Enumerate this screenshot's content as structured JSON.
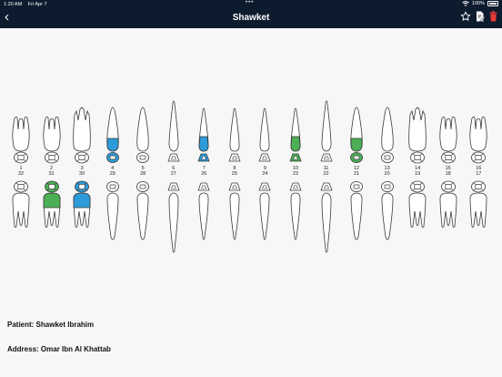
{
  "status_bar": {
    "time": "1:20 AM",
    "date": "Fri Apr 7",
    "battery": "100%"
  },
  "header": {
    "title": "Shawket"
  },
  "upper_teeth": [
    {
      "num": "1",
      "type": "molar",
      "fill": "none"
    },
    {
      "num": "2",
      "type": "molar",
      "fill": "none"
    },
    {
      "num": "3",
      "type": "molar3",
      "fill": "none"
    },
    {
      "num": "4",
      "type": "premolar",
      "fill": "blue"
    },
    {
      "num": "5",
      "type": "premolar",
      "fill": "none"
    },
    {
      "num": "6",
      "type": "canine",
      "fill": "none"
    },
    {
      "num": "7",
      "type": "incisor",
      "fill": "blue"
    },
    {
      "num": "8",
      "type": "incisor",
      "fill": "none"
    },
    {
      "num": "9",
      "type": "incisor",
      "fill": "none"
    },
    {
      "num": "10",
      "type": "incisor",
      "fill": "green"
    },
    {
      "num": "11",
      "type": "canine",
      "fill": "none"
    },
    {
      "num": "12",
      "type": "premolar",
      "fill": "green"
    },
    {
      "num": "13",
      "type": "premolar",
      "fill": "none"
    },
    {
      "num": "14",
      "type": "molar3",
      "fill": "none"
    },
    {
      "num": "15",
      "type": "molar",
      "fill": "none"
    },
    {
      "num": "16",
      "type": "molar",
      "fill": "none"
    }
  ],
  "upper_occlusal_fill": [
    "none",
    "none",
    "none",
    "blue",
    "none",
    "none",
    "blue",
    "none",
    "none",
    "green",
    "none",
    "green",
    "none",
    "none",
    "none",
    "none"
  ],
  "lower_teeth": [
    {
      "num": "32",
      "type": "molar",
      "fill": "none"
    },
    {
      "num": "31",
      "type": "molar",
      "fill": "green"
    },
    {
      "num": "30",
      "type": "molar",
      "fill": "blue"
    },
    {
      "num": "29",
      "type": "premolar",
      "fill": "none"
    },
    {
      "num": "28",
      "type": "premolar",
      "fill": "none"
    },
    {
      "num": "27",
      "type": "canine",
      "fill": "none"
    },
    {
      "num": "26",
      "type": "incisor",
      "fill": "none"
    },
    {
      "num": "25",
      "type": "incisor",
      "fill": "none"
    },
    {
      "num": "24",
      "type": "incisor",
      "fill": "none"
    },
    {
      "num": "23",
      "type": "incisor",
      "fill": "none"
    },
    {
      "num": "22",
      "type": "canine",
      "fill": "none"
    },
    {
      "num": "21",
      "type": "premolar",
      "fill": "none"
    },
    {
      "num": "20",
      "type": "premolar",
      "fill": "none"
    },
    {
      "num": "19",
      "type": "molar",
      "fill": "none"
    },
    {
      "num": "18",
      "type": "molar",
      "fill": "none"
    },
    {
      "num": "17",
      "type": "molar",
      "fill": "none"
    }
  ],
  "lower_occlusal_fill": [
    "none",
    "green",
    "blue",
    "none",
    "none",
    "none",
    "none",
    "none",
    "none",
    "none",
    "none",
    "none",
    "none",
    "none",
    "none",
    "none"
  ],
  "colors": {
    "header_bg": "#0d1b2e",
    "blue": "#2d9bd9",
    "green": "#4caf55",
    "delete": "#e53935"
  },
  "patient": {
    "name_label": "Patient: Shawket Ibrahim",
    "address_label": "Address: Omar Ibn Al Khattab"
  }
}
